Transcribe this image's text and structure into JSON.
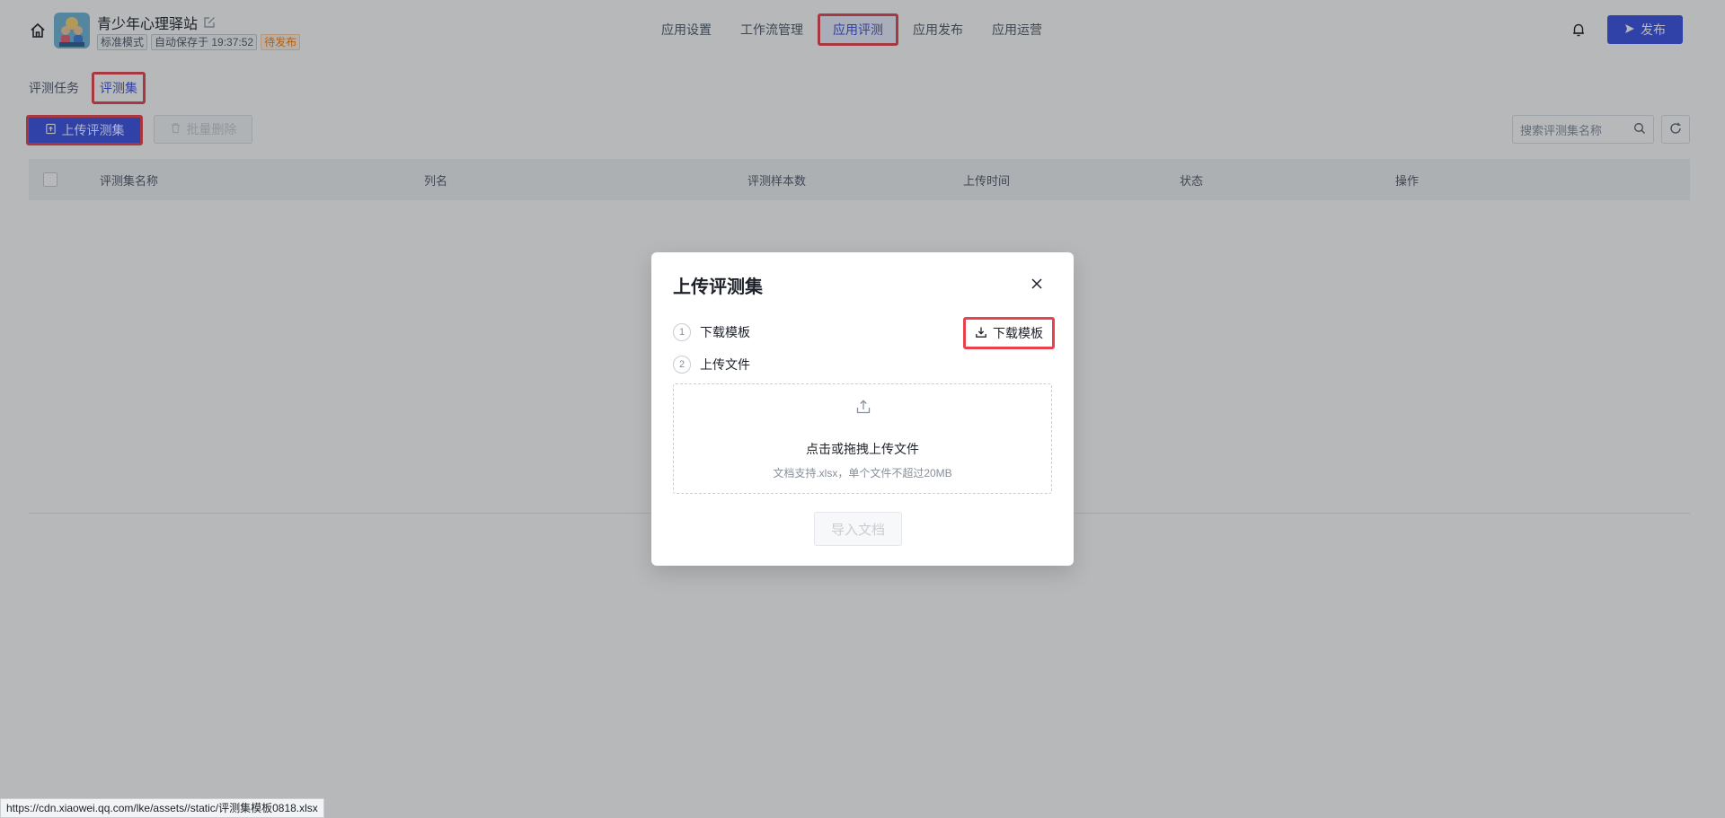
{
  "app": {
    "name": "青少年心理驿站",
    "tags": [
      "标准模式",
      "自动保存于 19:37:52",
      "待发布"
    ]
  },
  "top_nav": {
    "items": [
      "应用设置",
      "工作流管理",
      "应用评测",
      "应用发布",
      "应用运营"
    ],
    "active_index": 2
  },
  "publish_button": "发布",
  "sub_tabs": {
    "items": [
      "评测任务",
      "评测集"
    ],
    "active_index": 1
  },
  "toolbar": {
    "upload_label": "上传评测集",
    "batch_delete_label": "批量删除",
    "search_placeholder": "搜索评测集名称"
  },
  "table": {
    "columns": [
      "评测集名称",
      "列名",
      "评测样本数",
      "上传时间",
      "状态",
      "操作"
    ]
  },
  "modal": {
    "title": "上传评测集",
    "step1_num": "1",
    "step1_label": "下载模板",
    "step2_num": "2",
    "step2_label": "上传文件",
    "download_button": "下载模板",
    "dropzone_title": "点击或拖拽上传文件",
    "dropzone_hint": "文档支持.xlsx，单个文件不超过20MB",
    "import_button": "导入文档"
  },
  "status_bar": {
    "url": "https://cdn.xiaowei.qq.com/lke/assets//static/评测集模板0818.xlsx"
  },
  "colors": {
    "primary": "#3a52e3",
    "highlight_border": "#e8434d",
    "pending_tag": "#ff7d00"
  },
  "icons": [
    "home-icon",
    "edit-icon",
    "bell-icon",
    "send-icon",
    "upload-file-icon",
    "trash-icon",
    "search-icon",
    "refresh-icon",
    "close-icon",
    "download-icon",
    "upload-icon"
  ]
}
